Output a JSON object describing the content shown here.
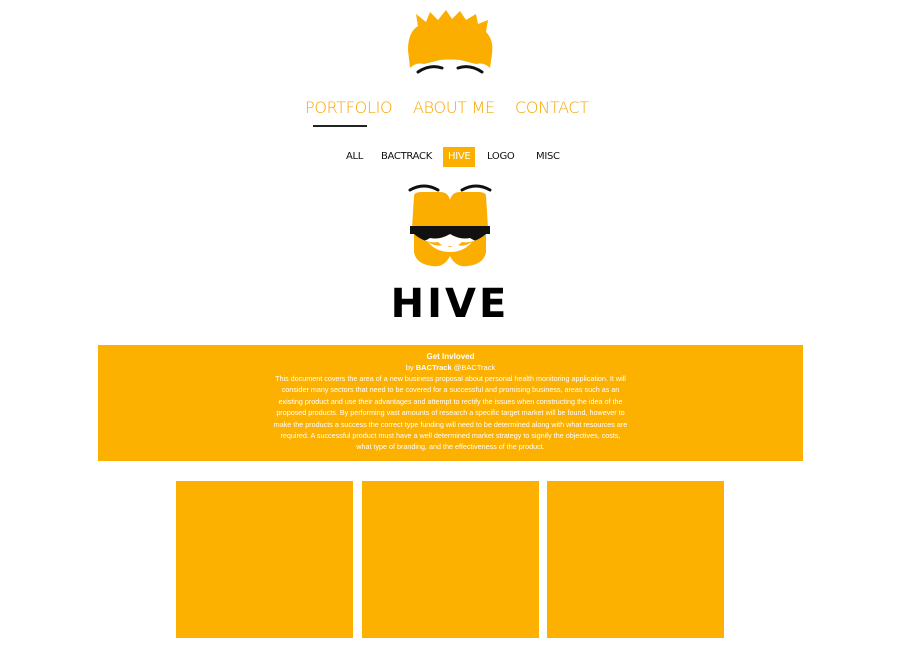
{
  "nav": {
    "items": [
      {
        "label": "PORTFOLIO"
      },
      {
        "label": "ABOUT ME"
      },
      {
        "label": "CONTACT"
      }
    ],
    "active": "PORTFOLIO"
  },
  "filters": {
    "items": [
      {
        "label": "ALL"
      },
      {
        "label": "BACTRACK"
      },
      {
        "label": "HIVE"
      },
      {
        "label": "LOGO"
      },
      {
        "label": "MISC"
      }
    ],
    "active": "HIVE"
  },
  "project": {
    "name": "HIVE",
    "title": "Get Invloved",
    "by_prefix": "by",
    "author": "BACTrack",
    "handle": "@BACTrack",
    "description": "This document covers the area of a new business proposal about personal health monitoring application. It will consider many sectors that need to be covered for a successful and promising business, areas such as an existing product and use their advantages and attempt to rectify the issues when constructing the idea of the proposed products. By performing vast amounts of research a specific target market will be found, however to make the products a success the correct type funding will need to be determined along with what resources are required. A successful product must have a well determined market strategy to signify the objectives, costs, what type of branding, and the effectiveness of the product."
  },
  "icons": {
    "site_logo": "hair-face-logo-icon",
    "project_logo": "hive-bearded-face-icon"
  },
  "colors": {
    "accent": "#fcb000",
    "nav_text": "#f5a500",
    "text_dark": "#111111",
    "background": "#ffffff"
  },
  "gallery": {
    "tile_count": 3
  }
}
